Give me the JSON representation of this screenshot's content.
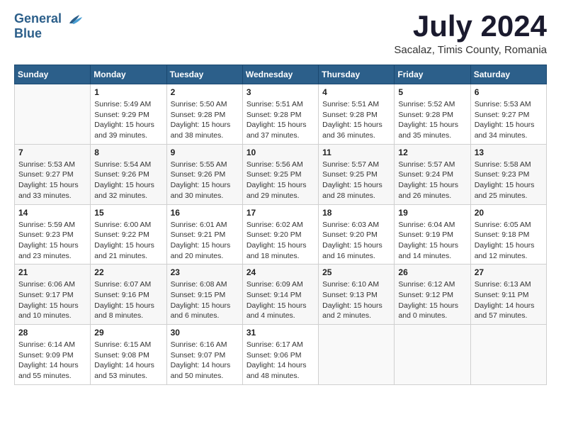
{
  "header": {
    "logo_general": "General",
    "logo_blue": "Blue",
    "month_title": "July 2024",
    "subtitle": "Sacalaz, Timis County, Romania"
  },
  "weekdays": [
    "Sunday",
    "Monday",
    "Tuesday",
    "Wednesday",
    "Thursday",
    "Friday",
    "Saturday"
  ],
  "weeks": [
    [
      {
        "day": "",
        "info": ""
      },
      {
        "day": "1",
        "info": "Sunrise: 5:49 AM\nSunset: 9:29 PM\nDaylight: 15 hours\nand 39 minutes."
      },
      {
        "day": "2",
        "info": "Sunrise: 5:50 AM\nSunset: 9:28 PM\nDaylight: 15 hours\nand 38 minutes."
      },
      {
        "day": "3",
        "info": "Sunrise: 5:51 AM\nSunset: 9:28 PM\nDaylight: 15 hours\nand 37 minutes."
      },
      {
        "day": "4",
        "info": "Sunrise: 5:51 AM\nSunset: 9:28 PM\nDaylight: 15 hours\nand 36 minutes."
      },
      {
        "day": "5",
        "info": "Sunrise: 5:52 AM\nSunset: 9:28 PM\nDaylight: 15 hours\nand 35 minutes."
      },
      {
        "day": "6",
        "info": "Sunrise: 5:53 AM\nSunset: 9:27 PM\nDaylight: 15 hours\nand 34 minutes."
      }
    ],
    [
      {
        "day": "7",
        "info": "Sunrise: 5:53 AM\nSunset: 9:27 PM\nDaylight: 15 hours\nand 33 minutes."
      },
      {
        "day": "8",
        "info": "Sunrise: 5:54 AM\nSunset: 9:26 PM\nDaylight: 15 hours\nand 32 minutes."
      },
      {
        "day": "9",
        "info": "Sunrise: 5:55 AM\nSunset: 9:26 PM\nDaylight: 15 hours\nand 30 minutes."
      },
      {
        "day": "10",
        "info": "Sunrise: 5:56 AM\nSunset: 9:25 PM\nDaylight: 15 hours\nand 29 minutes."
      },
      {
        "day": "11",
        "info": "Sunrise: 5:57 AM\nSunset: 9:25 PM\nDaylight: 15 hours\nand 28 minutes."
      },
      {
        "day": "12",
        "info": "Sunrise: 5:57 AM\nSunset: 9:24 PM\nDaylight: 15 hours\nand 26 minutes."
      },
      {
        "day": "13",
        "info": "Sunrise: 5:58 AM\nSunset: 9:23 PM\nDaylight: 15 hours\nand 25 minutes."
      }
    ],
    [
      {
        "day": "14",
        "info": "Sunrise: 5:59 AM\nSunset: 9:23 PM\nDaylight: 15 hours\nand 23 minutes."
      },
      {
        "day": "15",
        "info": "Sunrise: 6:00 AM\nSunset: 9:22 PM\nDaylight: 15 hours\nand 21 minutes."
      },
      {
        "day": "16",
        "info": "Sunrise: 6:01 AM\nSunset: 9:21 PM\nDaylight: 15 hours\nand 20 minutes."
      },
      {
        "day": "17",
        "info": "Sunrise: 6:02 AM\nSunset: 9:20 PM\nDaylight: 15 hours\nand 18 minutes."
      },
      {
        "day": "18",
        "info": "Sunrise: 6:03 AM\nSunset: 9:20 PM\nDaylight: 15 hours\nand 16 minutes."
      },
      {
        "day": "19",
        "info": "Sunrise: 6:04 AM\nSunset: 9:19 PM\nDaylight: 15 hours\nand 14 minutes."
      },
      {
        "day": "20",
        "info": "Sunrise: 6:05 AM\nSunset: 9:18 PM\nDaylight: 15 hours\nand 12 minutes."
      }
    ],
    [
      {
        "day": "21",
        "info": "Sunrise: 6:06 AM\nSunset: 9:17 PM\nDaylight: 15 hours\nand 10 minutes."
      },
      {
        "day": "22",
        "info": "Sunrise: 6:07 AM\nSunset: 9:16 PM\nDaylight: 15 hours\nand 8 minutes."
      },
      {
        "day": "23",
        "info": "Sunrise: 6:08 AM\nSunset: 9:15 PM\nDaylight: 15 hours\nand 6 minutes."
      },
      {
        "day": "24",
        "info": "Sunrise: 6:09 AM\nSunset: 9:14 PM\nDaylight: 15 hours\nand 4 minutes."
      },
      {
        "day": "25",
        "info": "Sunrise: 6:10 AM\nSunset: 9:13 PM\nDaylight: 15 hours\nand 2 minutes."
      },
      {
        "day": "26",
        "info": "Sunrise: 6:12 AM\nSunset: 9:12 PM\nDaylight: 15 hours\nand 0 minutes."
      },
      {
        "day": "27",
        "info": "Sunrise: 6:13 AM\nSunset: 9:11 PM\nDaylight: 14 hours\nand 57 minutes."
      }
    ],
    [
      {
        "day": "28",
        "info": "Sunrise: 6:14 AM\nSunset: 9:09 PM\nDaylight: 14 hours\nand 55 minutes."
      },
      {
        "day": "29",
        "info": "Sunrise: 6:15 AM\nSunset: 9:08 PM\nDaylight: 14 hours\nand 53 minutes."
      },
      {
        "day": "30",
        "info": "Sunrise: 6:16 AM\nSunset: 9:07 PM\nDaylight: 14 hours\nand 50 minutes."
      },
      {
        "day": "31",
        "info": "Sunrise: 6:17 AM\nSunset: 9:06 PM\nDaylight: 14 hours\nand 48 minutes."
      },
      {
        "day": "",
        "info": ""
      },
      {
        "day": "",
        "info": ""
      },
      {
        "day": "",
        "info": ""
      }
    ]
  ]
}
